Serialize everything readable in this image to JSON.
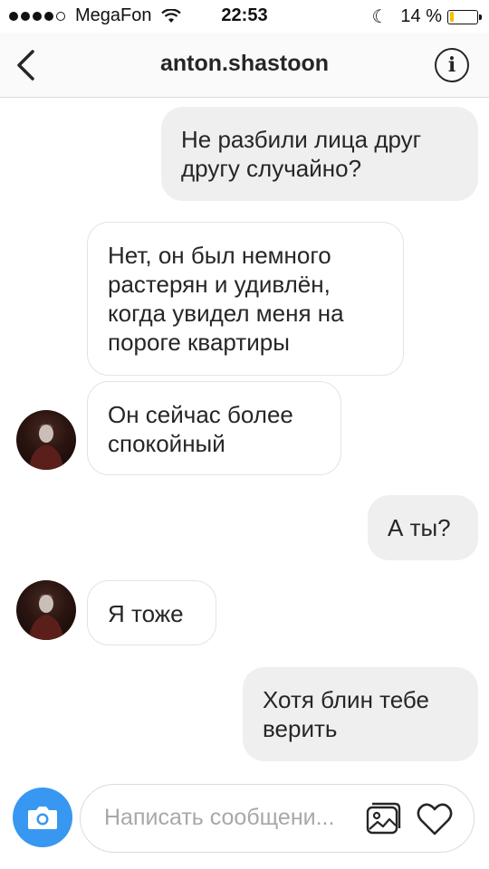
{
  "status_bar": {
    "carrier": "MegaFon",
    "time": "22:53",
    "battery": "14 %",
    "battery_level": 0.14
  },
  "header": {
    "username": "anton.shastoon",
    "back_icon": "chevron-left-icon",
    "info_icon": "info-icon",
    "info_glyph": "i"
  },
  "messages": [
    {
      "from": "me",
      "text": "Не разбили лица друг другу случайно?"
    },
    {
      "from": "them",
      "text": "Нет, он был немного растерян и удивлён, когда увидел меня на пороге квартиры"
    },
    {
      "from": "them",
      "text": "Он сейчас более спокойный"
    },
    {
      "from": "me",
      "text": "А ты?"
    },
    {
      "from": "them",
      "text": "Я тоже"
    },
    {
      "from": "me",
      "text": "Хотя блин тебе верить"
    }
  ],
  "composer": {
    "placeholder": "Написать сообщени...",
    "camera_icon": "camera-icon",
    "gallery_icon": "gallery-icon",
    "heart_icon": "heart-icon"
  },
  "colors": {
    "accent": "#3897f0",
    "sent_bubble": "#efefef",
    "received_border": "#e3e3e3",
    "battery_fill": "#f2c200"
  }
}
